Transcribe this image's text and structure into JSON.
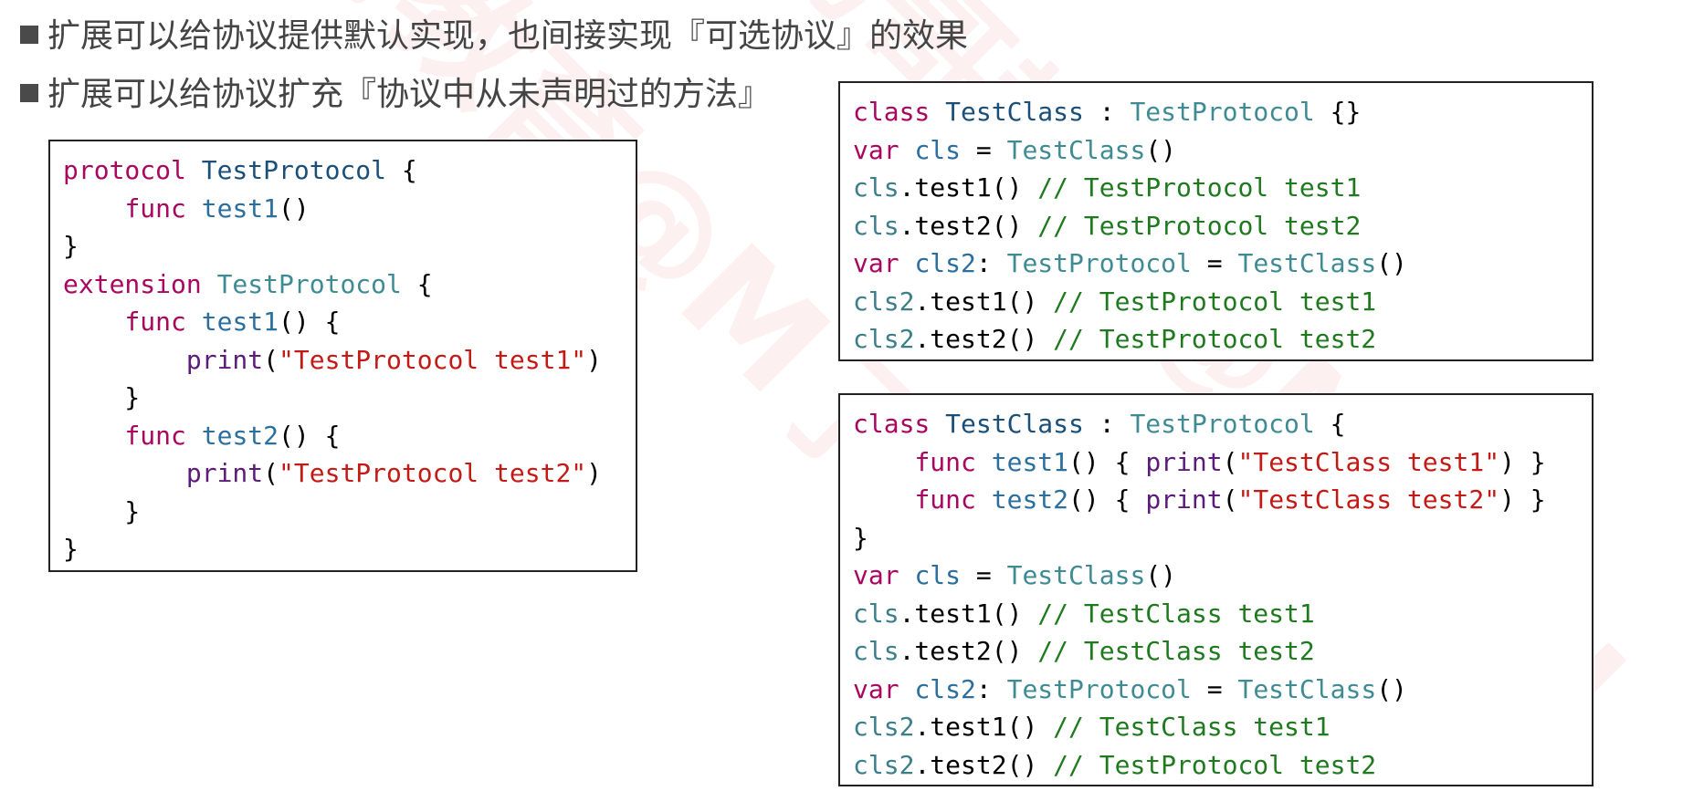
{
  "bullets": [
    "扩展可以给协议提供默认实现，也间接实现『可选协议』的效果",
    "扩展可以给协议扩充『协议中从未声明过的方法』"
  ],
  "watermark": "小码哥教育@M了个J",
  "code_left": [
    [
      {
        "t": "kw",
        "s": "protocol"
      },
      {
        "t": "plain",
        "s": " "
      },
      {
        "t": "type",
        "s": "TestProtocol"
      },
      {
        "t": "plain",
        "s": " {"
      }
    ],
    [
      {
        "t": "plain",
        "s": "    "
      },
      {
        "t": "kw",
        "s": "func"
      },
      {
        "t": "plain",
        "s": " "
      },
      {
        "t": "fn",
        "s": "test1"
      },
      {
        "t": "plain",
        "s": "()"
      }
    ],
    [
      {
        "t": "plain",
        "s": "}"
      }
    ],
    [
      {
        "t": "kw",
        "s": "extension"
      },
      {
        "t": "plain",
        "s": " "
      },
      {
        "t": "proto",
        "s": "TestProtocol"
      },
      {
        "t": "plain",
        "s": " {"
      }
    ],
    [
      {
        "t": "plain",
        "s": "    "
      },
      {
        "t": "kw",
        "s": "func"
      },
      {
        "t": "plain",
        "s": " "
      },
      {
        "t": "fn",
        "s": "test1"
      },
      {
        "t": "plain",
        "s": "() {"
      }
    ],
    [
      {
        "t": "plain",
        "s": "        "
      },
      {
        "t": "print",
        "s": "print"
      },
      {
        "t": "plain",
        "s": "("
      },
      {
        "t": "str",
        "s": "\"TestProtocol test1\""
      },
      {
        "t": "plain",
        "s": ")"
      }
    ],
    [
      {
        "t": "plain",
        "s": "    }"
      }
    ],
    [
      {
        "t": "plain",
        "s": "    "
      },
      {
        "t": "kw",
        "s": "func"
      },
      {
        "t": "plain",
        "s": " "
      },
      {
        "t": "fn",
        "s": "test2"
      },
      {
        "t": "plain",
        "s": "() {"
      }
    ],
    [
      {
        "t": "plain",
        "s": "        "
      },
      {
        "t": "print",
        "s": "print"
      },
      {
        "t": "plain",
        "s": "("
      },
      {
        "t": "str",
        "s": "\"TestProtocol test2\""
      },
      {
        "t": "plain",
        "s": ")"
      }
    ],
    [
      {
        "t": "plain",
        "s": "    }"
      }
    ],
    [
      {
        "t": "plain",
        "s": "}"
      }
    ]
  ],
  "code_right_top": [
    [
      {
        "t": "kw",
        "s": "class"
      },
      {
        "t": "plain",
        "s": " "
      },
      {
        "t": "type",
        "s": "TestClass"
      },
      {
        "t": "plain",
        "s": " : "
      },
      {
        "t": "proto",
        "s": "TestProtocol"
      },
      {
        "t": "plain",
        "s": " {}"
      }
    ],
    [
      {
        "t": "kw",
        "s": "var"
      },
      {
        "t": "plain",
        "s": " "
      },
      {
        "t": "fn",
        "s": "cls"
      },
      {
        "t": "plain",
        "s": " = "
      },
      {
        "t": "proto",
        "s": "TestClass"
      },
      {
        "t": "plain",
        "s": "()"
      }
    ],
    [
      {
        "t": "var",
        "s": "cls"
      },
      {
        "t": "plain",
        "s": ".test1() "
      },
      {
        "t": "cmt",
        "s": "// TestProtocol test1"
      }
    ],
    [
      {
        "t": "var",
        "s": "cls"
      },
      {
        "t": "plain",
        "s": ".test2() "
      },
      {
        "t": "cmt",
        "s": "// TestProtocol test2"
      }
    ],
    [
      {
        "t": "kw",
        "s": "var"
      },
      {
        "t": "plain",
        "s": " "
      },
      {
        "t": "fn",
        "s": "cls2"
      },
      {
        "t": "plain",
        "s": ": "
      },
      {
        "t": "proto",
        "s": "TestProtocol"
      },
      {
        "t": "plain",
        "s": " = "
      },
      {
        "t": "proto",
        "s": "TestClass"
      },
      {
        "t": "plain",
        "s": "()"
      }
    ],
    [
      {
        "t": "var",
        "s": "cls2"
      },
      {
        "t": "plain",
        "s": ".test1() "
      },
      {
        "t": "cmt",
        "s": "// TestProtocol test1"
      }
    ],
    [
      {
        "t": "var",
        "s": "cls2"
      },
      {
        "t": "plain",
        "s": ".test2() "
      },
      {
        "t": "cmt",
        "s": "// TestProtocol test2"
      }
    ]
  ],
  "code_right_bottom": [
    [
      {
        "t": "kw",
        "s": "class"
      },
      {
        "t": "plain",
        "s": " "
      },
      {
        "t": "type",
        "s": "TestClass"
      },
      {
        "t": "plain",
        "s": " : "
      },
      {
        "t": "proto",
        "s": "TestProtocol"
      },
      {
        "t": "plain",
        "s": " {"
      }
    ],
    [
      {
        "t": "plain",
        "s": "    "
      },
      {
        "t": "kw",
        "s": "func"
      },
      {
        "t": "plain",
        "s": " "
      },
      {
        "t": "fn",
        "s": "test1"
      },
      {
        "t": "plain",
        "s": "() { "
      },
      {
        "t": "print",
        "s": "print"
      },
      {
        "t": "plain",
        "s": "("
      },
      {
        "t": "str",
        "s": "\"TestClass test1\""
      },
      {
        "t": "plain",
        "s": ") }"
      }
    ],
    [
      {
        "t": "plain",
        "s": "    "
      },
      {
        "t": "kw",
        "s": "func"
      },
      {
        "t": "plain",
        "s": " "
      },
      {
        "t": "fn",
        "s": "test2"
      },
      {
        "t": "plain",
        "s": "() { "
      },
      {
        "t": "print",
        "s": "print"
      },
      {
        "t": "plain",
        "s": "("
      },
      {
        "t": "str",
        "s": "\"TestClass test2\""
      },
      {
        "t": "plain",
        "s": ") }"
      }
    ],
    [
      {
        "t": "plain",
        "s": "}"
      }
    ],
    [
      {
        "t": "kw",
        "s": "var"
      },
      {
        "t": "plain",
        "s": " "
      },
      {
        "t": "fn",
        "s": "cls"
      },
      {
        "t": "plain",
        "s": " = "
      },
      {
        "t": "proto",
        "s": "TestClass"
      },
      {
        "t": "plain",
        "s": "()"
      }
    ],
    [
      {
        "t": "var",
        "s": "cls"
      },
      {
        "t": "plain",
        "s": ".test1() "
      },
      {
        "t": "cmt",
        "s": "// TestClass test1"
      }
    ],
    [
      {
        "t": "var",
        "s": "cls"
      },
      {
        "t": "plain",
        "s": ".test2() "
      },
      {
        "t": "cmt",
        "s": "// TestClass test2"
      }
    ],
    [
      {
        "t": "kw",
        "s": "var"
      },
      {
        "t": "plain",
        "s": " "
      },
      {
        "t": "fn",
        "s": "cls2"
      },
      {
        "t": "plain",
        "s": ": "
      },
      {
        "t": "proto",
        "s": "TestProtocol"
      },
      {
        "t": "plain",
        "s": " = "
      },
      {
        "t": "proto",
        "s": "TestClass"
      },
      {
        "t": "plain",
        "s": "()"
      }
    ],
    [
      {
        "t": "var",
        "s": "cls2"
      },
      {
        "t": "plain",
        "s": ".test1() "
      },
      {
        "t": "cmt",
        "s": "// TestClass test1"
      }
    ],
    [
      {
        "t": "var",
        "s": "cls2"
      },
      {
        "t": "plain",
        "s": ".test2() "
      },
      {
        "t": "cmt",
        "s": "// TestProtocol test2"
      }
    ]
  ]
}
